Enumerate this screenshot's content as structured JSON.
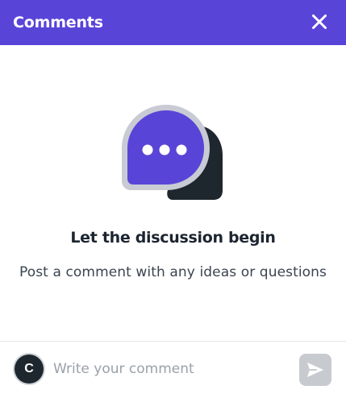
{
  "header": {
    "title": "Comments",
    "background_color": "#5944d8",
    "close_icon": "close-icon"
  },
  "empty_state": {
    "illustration_icon": "chat-bubbles-icon",
    "title": "Let the discussion begin",
    "subtitle": "Post a comment with any ideas or questions",
    "accent_color": "#5944d8"
  },
  "composer": {
    "avatar_initial": "C",
    "placeholder": "Write your comment",
    "value": "",
    "send_icon": "send-icon"
  }
}
